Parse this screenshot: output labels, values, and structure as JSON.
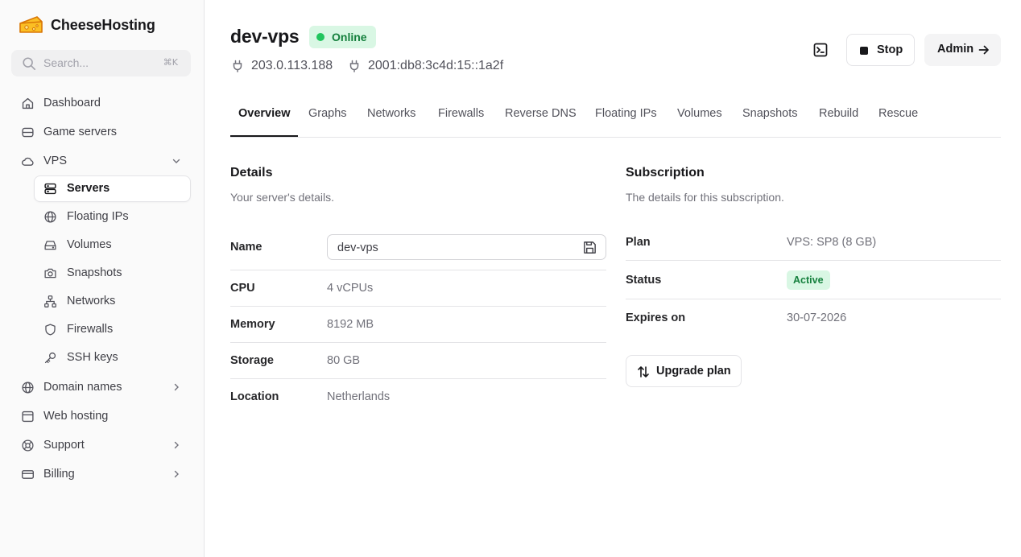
{
  "brand": {
    "name": "CheeseHosting"
  },
  "search": {
    "placeholder": "Search...",
    "shortcut": "⌘K"
  },
  "sidebar": {
    "items": [
      {
        "label": "Dashboard",
        "icon": "home-icon"
      },
      {
        "label": "Game servers",
        "icon": "database-icon"
      },
      {
        "label": "VPS",
        "icon": "cloud-icon",
        "expanded": true
      },
      {
        "label": "Domain names",
        "icon": "globe-icon"
      },
      {
        "label": "Web hosting",
        "icon": "browser-window-icon"
      },
      {
        "label": "Support",
        "icon": "lifebuoy-icon"
      },
      {
        "label": "Billing",
        "icon": "credit-card-icon"
      }
    ],
    "vps_sub": [
      {
        "label": "Servers",
        "icon": "server-icon",
        "active": true
      },
      {
        "label": "Floating IPs",
        "icon": "globe-icon"
      },
      {
        "label": "Volumes",
        "icon": "hard-drive-icon"
      },
      {
        "label": "Snapshots",
        "icon": "camera-icon"
      },
      {
        "label": "Networks",
        "icon": "network-icon"
      },
      {
        "label": "Firewalls",
        "icon": "shield-icon"
      },
      {
        "label": "SSH keys",
        "icon": "key-icon"
      }
    ]
  },
  "header": {
    "title": "dev-vps",
    "status": "Online",
    "ipv4": "203.0.113.188",
    "ipv6": "2001:db8:3c4d:15::1a2f",
    "stop_label": "Stop",
    "admin_label": "Admin"
  },
  "tabs": [
    "Overview",
    "Graphs",
    "Networks",
    "Firewalls",
    "Reverse DNS",
    "Floating IPs",
    "Volumes",
    "Snapshots",
    "Rebuild",
    "Rescue"
  ],
  "details": {
    "title": "Details",
    "subtitle": "Your server's details.",
    "name_label": "Name",
    "name_value": "dev-vps",
    "rows": [
      {
        "label": "CPU",
        "value": "4 vCPUs"
      },
      {
        "label": "Memory",
        "value": "8192 MB"
      },
      {
        "label": "Storage",
        "value": "80 GB"
      },
      {
        "label": "Location",
        "value": "Netherlands"
      }
    ]
  },
  "subscription": {
    "title": "Subscription",
    "subtitle": "The details for this subscription.",
    "plan_label": "Plan",
    "plan_value": "VPS: SP8 (8 GB)",
    "status_label": "Status",
    "status_value": "Active",
    "expires_label": "Expires on",
    "expires_value": "30-07-2026",
    "upgrade_label": "Upgrade plan"
  },
  "colors": {
    "accent_green": "#15803d",
    "green_bg": "#d9f7e4",
    "status_dot": "#22c55e",
    "logo_yellow": "#fbbf24"
  }
}
